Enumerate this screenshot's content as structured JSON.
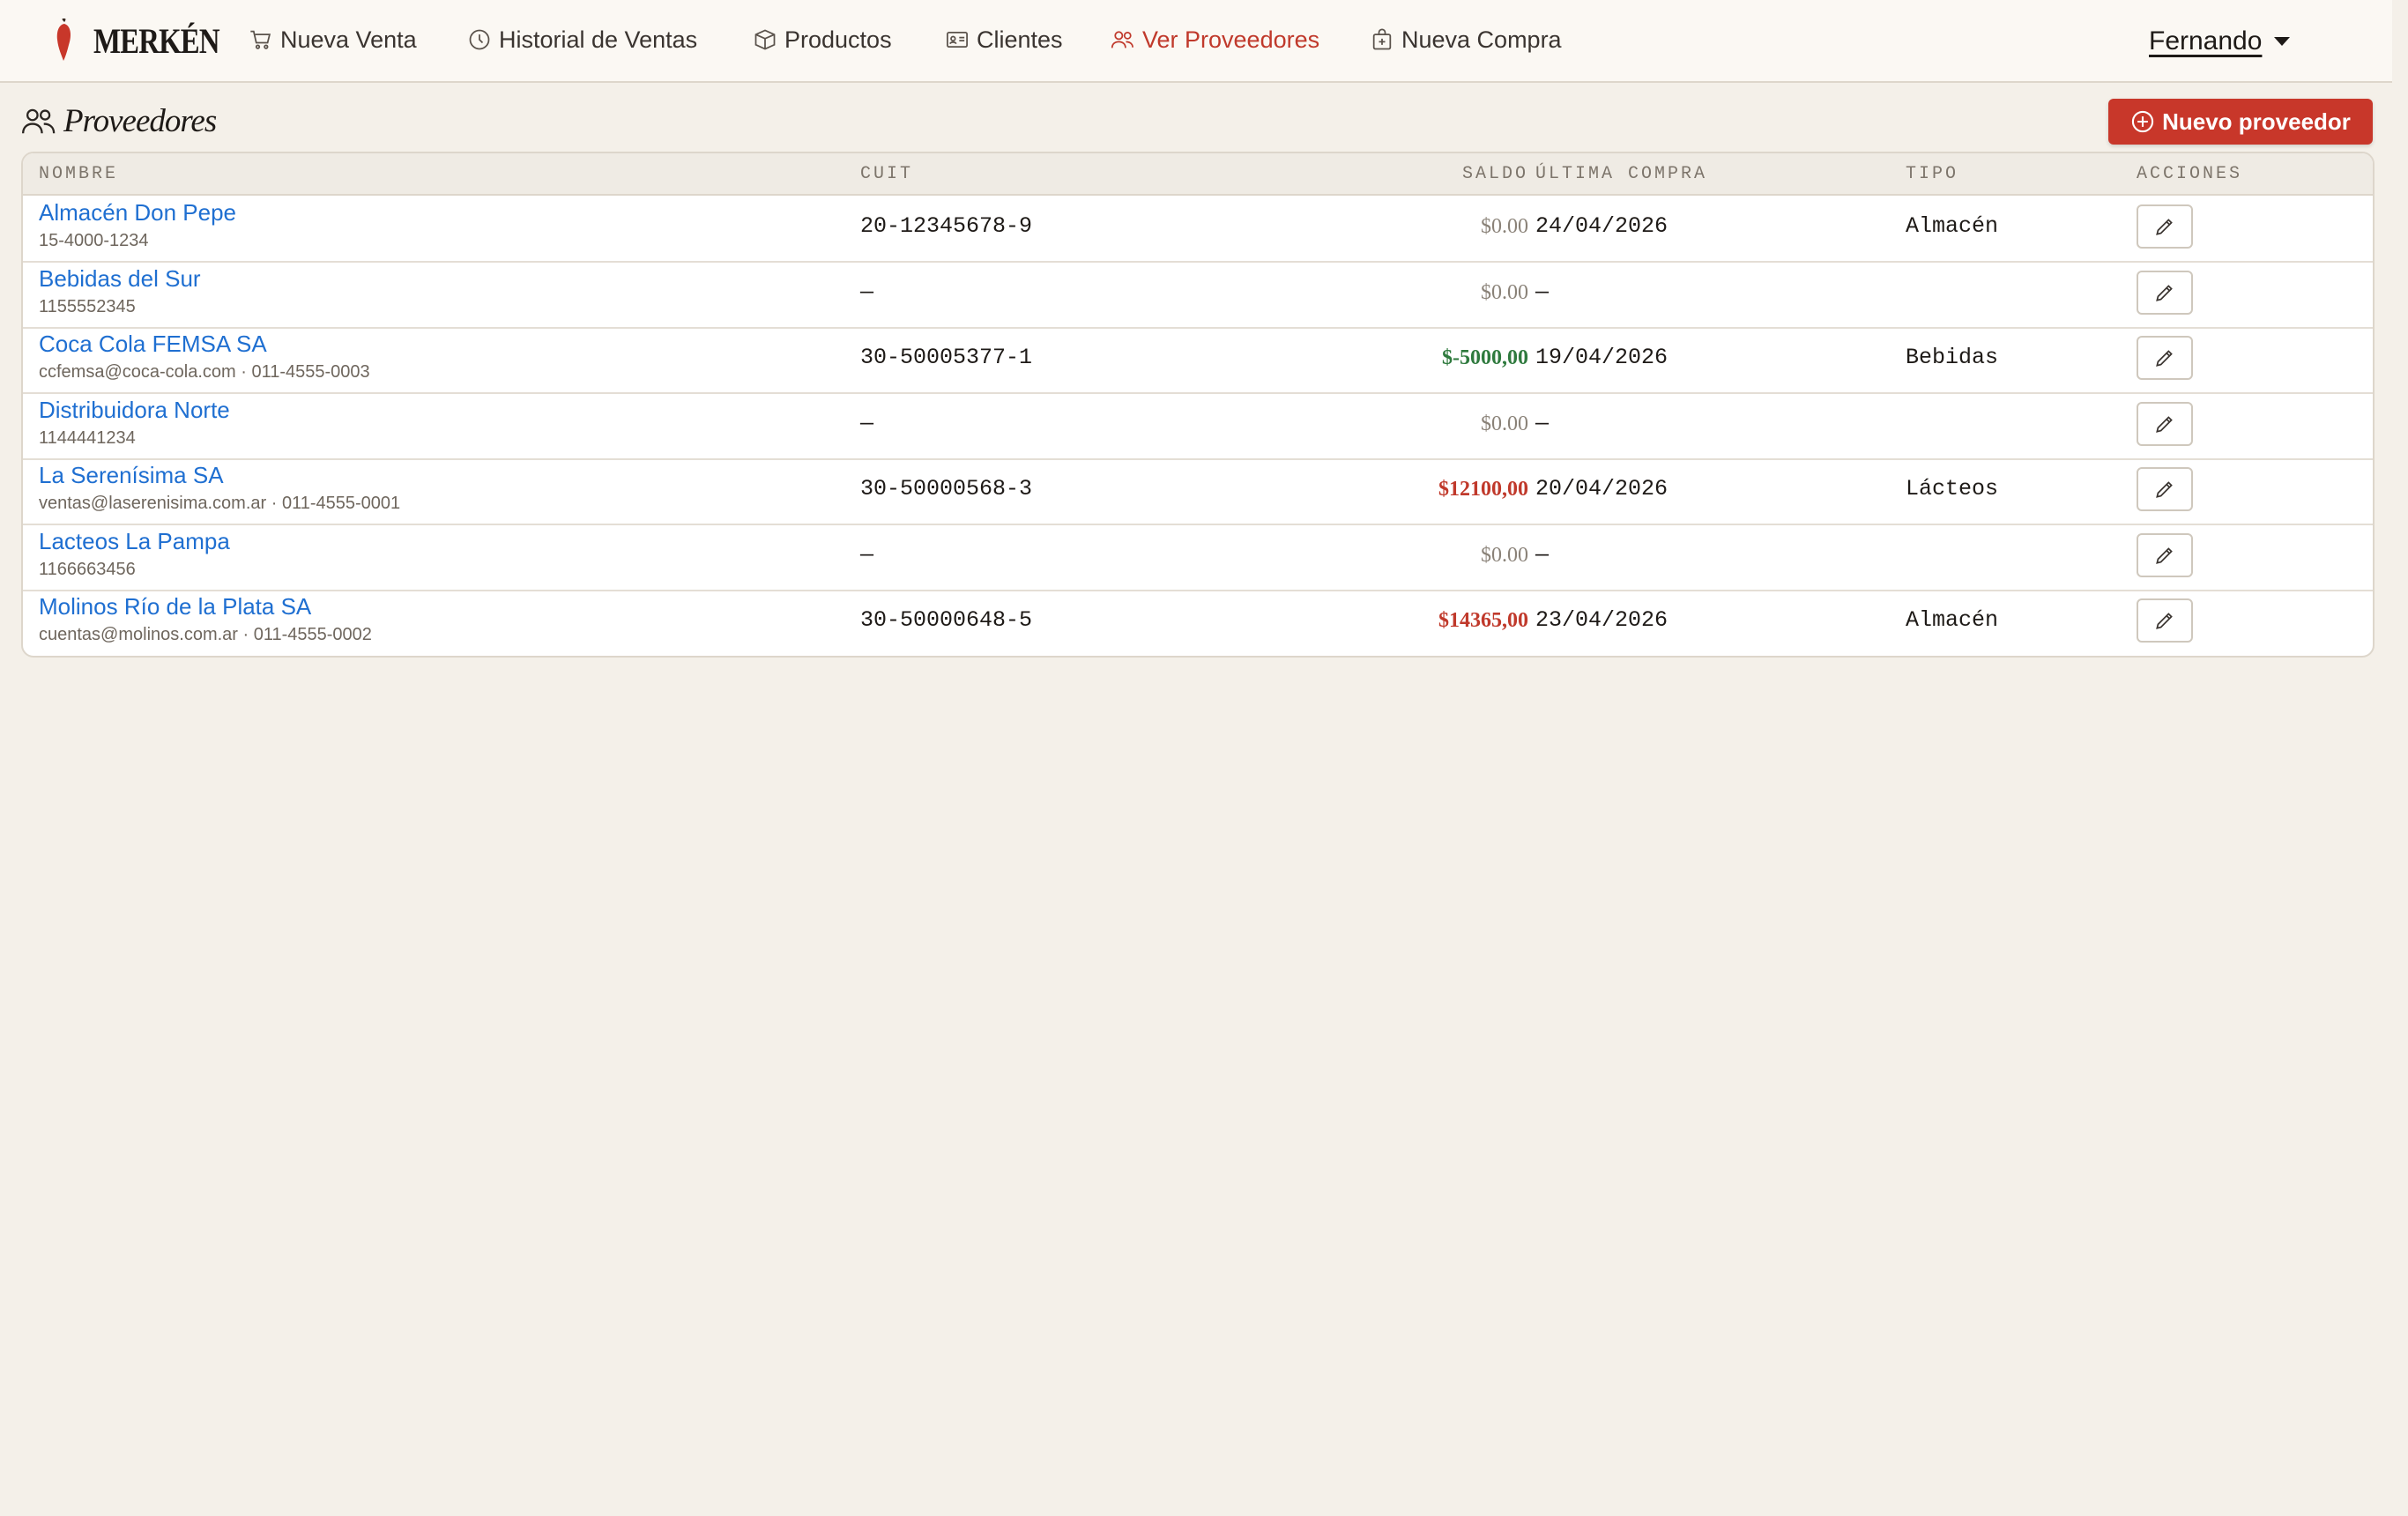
{
  "brand": {
    "name": "MERKÉN"
  },
  "nav": [
    {
      "label": "Nueva Venta",
      "icon": "cart-icon"
    },
    {
      "label": "Historial de Ventas",
      "icon": "clock-icon"
    },
    {
      "label": "Productos",
      "icon": "box-icon"
    },
    {
      "label": "Clientes",
      "icon": "id-card-icon"
    },
    {
      "label": "Ver Proveedores",
      "icon": "users-icon",
      "active": true
    },
    {
      "label": "Nueva Compra",
      "icon": "bag-plus-icon"
    }
  ],
  "user": {
    "name": "Fernando"
  },
  "page": {
    "title": "Proveedores",
    "new_button": "Nuevo proveedor"
  },
  "table": {
    "headers": [
      "NOMBRE",
      "CUIT",
      "SALDO",
      "ÚLTIMA COMPRA",
      "TIPO",
      "ACCIONES"
    ],
    "rows": [
      {
        "name": "Almacén Don Pepe",
        "contact": "15-4000-1234",
        "cuit": "20-12345678-9",
        "saldo": "$0.00",
        "saldo_status": "zero",
        "ultima_compra": "24/04/2026",
        "tipo": "Almacén"
      },
      {
        "name": "Bebidas del Sur",
        "contact": "1155552345",
        "cuit": "—",
        "saldo": "$0.00",
        "saldo_status": "zero",
        "ultima_compra": "—",
        "tipo": ""
      },
      {
        "name": "Coca Cola FEMSA SA",
        "contact": "ccfemsa@coca-cola.com · 011-4555-0003",
        "cuit": "30-50005377-1",
        "saldo": "$-5000,00",
        "saldo_status": "credit",
        "ultima_compra": "19/04/2026",
        "tipo": "Bebidas"
      },
      {
        "name": "Distribuidora Norte",
        "contact": "1144441234",
        "cuit": "—",
        "saldo": "$0.00",
        "saldo_status": "zero",
        "ultima_compra": "—",
        "tipo": ""
      },
      {
        "name": "La Serenísima SA",
        "contact": "ventas@laserenisima.com.ar · 011-4555-0001",
        "cuit": "30-50000568-3",
        "saldo": "$12100,00",
        "saldo_status": "debt",
        "ultima_compra": "20/04/2026",
        "tipo": "Lácteos"
      },
      {
        "name": "Lacteos La Pampa",
        "contact": "1166663456",
        "cuit": "—",
        "saldo": "$0.00",
        "saldo_status": "zero",
        "ultima_compra": "—",
        "tipo": ""
      },
      {
        "name": "Molinos Río de la Plata SA",
        "contact": "cuentas@molinos.com.ar · 011-4555-0002",
        "cuit": "30-50000648-5",
        "saldo": "$14365,00",
        "saldo_status": "debt",
        "ultima_compra": "23/04/2026",
        "tipo": "Almacén"
      }
    ]
  },
  "colors": {
    "accent": "#c8372a",
    "link": "#1f6fd1",
    "credit": "#2f7a3e",
    "debt": "#c0392b",
    "background": "#f4f0e9"
  }
}
